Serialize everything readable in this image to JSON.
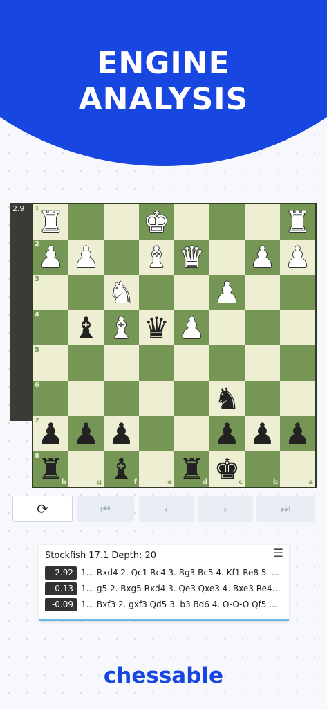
{
  "header": {
    "line1": "ENGINE",
    "line2": "ANALYSIS"
  },
  "eval_bar": {
    "label": "2.9",
    "white_fraction": 0.25
  },
  "board": {
    "ranks_top_to_bottom": [
      "1",
      "2",
      "3",
      "4",
      "5",
      "6",
      "7",
      "8"
    ],
    "files_left_to_right": [
      "h",
      "g",
      "f",
      "e",
      "d",
      "c",
      "b",
      "a"
    ],
    "pieces": [
      {
        "square": "h1",
        "glyph": "♜",
        "color": "white",
        "name": "white-rook"
      },
      {
        "square": "e1",
        "glyph": "♚",
        "color": "white",
        "name": "white-king"
      },
      {
        "square": "a1",
        "glyph": "♜",
        "color": "white",
        "name": "white-rook"
      },
      {
        "square": "h2",
        "glyph": "♟",
        "color": "white",
        "name": "white-pawn"
      },
      {
        "square": "g2",
        "glyph": "♟",
        "color": "white",
        "name": "white-pawn"
      },
      {
        "square": "e2",
        "glyph": "♝",
        "color": "white",
        "name": "white-bishop"
      },
      {
        "square": "d2",
        "glyph": "♛",
        "color": "white",
        "name": "white-queen"
      },
      {
        "square": "b2",
        "glyph": "♟",
        "color": "white",
        "name": "white-pawn"
      },
      {
        "square": "a2",
        "glyph": "♟",
        "color": "white",
        "name": "white-pawn"
      },
      {
        "square": "f3",
        "glyph": "♞",
        "color": "white",
        "name": "white-knight"
      },
      {
        "square": "c3",
        "glyph": "♟",
        "color": "white",
        "name": "white-pawn"
      },
      {
        "square": "g4",
        "glyph": "♝",
        "color": "black",
        "name": "black-bishop"
      },
      {
        "square": "f4",
        "glyph": "♝",
        "color": "white",
        "name": "white-bishop"
      },
      {
        "square": "e4",
        "glyph": "♛",
        "color": "black",
        "name": "black-queen"
      },
      {
        "square": "d4",
        "glyph": "♟",
        "color": "white",
        "name": "white-pawn"
      },
      {
        "square": "c6",
        "glyph": "♞",
        "color": "black",
        "name": "black-knight"
      },
      {
        "square": "h7",
        "glyph": "♟",
        "color": "black",
        "name": "black-pawn"
      },
      {
        "square": "g7",
        "glyph": "♟",
        "color": "black",
        "name": "black-pawn"
      },
      {
        "square": "f7",
        "glyph": "♟",
        "color": "black",
        "name": "black-pawn"
      },
      {
        "square": "c7",
        "glyph": "♟",
        "color": "black",
        "name": "black-pawn"
      },
      {
        "square": "b7",
        "glyph": "♟",
        "color": "black",
        "name": "black-pawn"
      },
      {
        "square": "a7",
        "glyph": "♟",
        "color": "black",
        "name": "black-pawn"
      },
      {
        "square": "h8",
        "glyph": "♜",
        "color": "black",
        "name": "black-rook"
      },
      {
        "square": "f8",
        "glyph": "♝",
        "color": "black",
        "name": "black-bishop"
      },
      {
        "square": "d8",
        "glyph": "♜",
        "color": "black",
        "name": "black-rook"
      },
      {
        "square": "c8",
        "glyph": "♚",
        "color": "black",
        "name": "black-king"
      }
    ],
    "colors": {
      "light": "#eeeed2",
      "dark": "#769656"
    }
  },
  "controls": {
    "refresh_icon": "⟳",
    "first_icon": "⏮",
    "prev_icon": "‹",
    "next_icon": "›",
    "last_icon": "⏭"
  },
  "engine": {
    "title": "Stockfish 17.1  Depth: 20",
    "settings_icon": "☰",
    "lines": [
      {
        "score": "-2.92",
        "moves": "1... Rxd4 2. Qc1 Rc4 3. Bg3 Bc5 4. Kf1 Re8 5. Q..."
      },
      {
        "score": "-0.13",
        "moves": "1... g5 2. Bxg5 Rxd4 3. Qe3 Qxe3 4. Bxe3 Re4 5..."
      },
      {
        "score": "-0.09",
        "moves": "1... Bxf3 2. gxf3 Qd5 3. b3 Bd6 4. O-O-O Qf5 5. ..."
      }
    ]
  },
  "footer": {
    "logo_text": "chessable"
  },
  "brand_color": "#1846e0"
}
